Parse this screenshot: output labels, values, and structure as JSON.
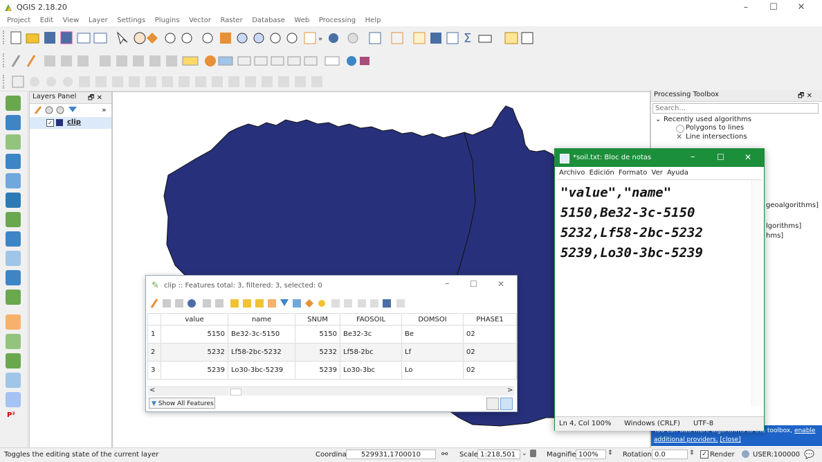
{
  "window": {
    "title": "QGIS 2.18.20",
    "minimize": "–",
    "maximize": "☐",
    "close": "✕"
  },
  "menubar": [
    "Project",
    "Edit",
    "View",
    "Layer",
    "Settings",
    "Plugins",
    "Vector",
    "Raster",
    "Database",
    "Web",
    "Processing",
    "Help"
  ],
  "layers_panel": {
    "title": "Layers Panel",
    "layer_name": "clip",
    "layer_checked": true,
    "more": "»",
    "header_icons": "🗗 ✕"
  },
  "toolbox": {
    "title": "Processing Toolbox",
    "header_icons": "🗗 ✕",
    "search_placeholder": "Search...",
    "tree": {
      "group": "Recently used algorithms",
      "items": [
        "Polygons to lines",
        "Line intersections"
      ],
      "partial": [
        "geoalgorithms]",
        "lgorithms]",
        "hms]"
      ]
    },
    "banner": "You can add more algorithms to the toolbox,",
    "banner_link": "enable additional providers.",
    "banner_close": "[close]"
  },
  "attribute_table": {
    "title": "clip :: Features total: 3, filtered: 3, selected: 0",
    "columns": [
      "value",
      "name",
      "SNUM",
      "FAOSOIL",
      "DOMSOI",
      "PHASE1"
    ],
    "rows": [
      [
        "1",
        "5150",
        "Be32-3c-5150",
        "5150",
        "Be32-3c",
        "Be",
        "02"
      ],
      [
        "2",
        "5232",
        "Lf58-2bc-5232",
        "5232",
        "Lf58-2bc",
        "Lf",
        "02"
      ],
      [
        "3",
        "5239",
        "Lo30-3bc-5239",
        "5239",
        "Lo30-3bc",
        "Lo",
        "02"
      ]
    ],
    "show_all": "Show All Features",
    "scroll_left": "<",
    "scroll_right": ">"
  },
  "notepad": {
    "title": "*soil.txt: Bloc de notas",
    "menu": [
      "Archivo",
      "Edición",
      "Formato",
      "Ver",
      "Ayuda"
    ],
    "lines": [
      "\"value\",\"name\"",
      "5150,Be32-3c-5150",
      "5232,Lf58-2bc-5232",
      "5239,Lo30-3bc-5239"
    ],
    "status": {
      "position": "Ln 4, Col 100%",
      "eol": "Windows (CRLF)",
      "encoding": "UTF-8"
    }
  },
  "statusbar": {
    "message": "Toggles the editing state of the current layer",
    "coordinate_label": "Coordinate",
    "coordinate": "529931,1700010",
    "scale_label": "Scale",
    "scale": "1:218,501",
    "magnifier_label": "Magnifier",
    "magnifier": "100%",
    "rotation_label": "Rotation",
    "rotation": "0.0",
    "render_label": "Render",
    "render_checked": true,
    "crs": "USER:100000"
  },
  "colors": {
    "polygon": "#27307a",
    "notepad_border": "#1c8f3a",
    "link": "#1a56d6",
    "banner": "#1e64c8"
  }
}
